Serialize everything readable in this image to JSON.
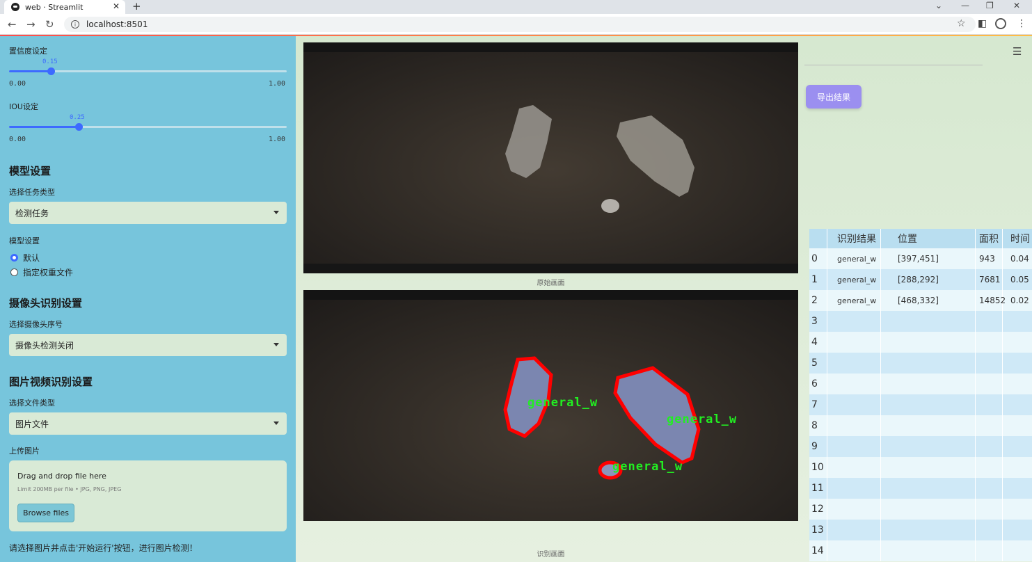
{
  "browser": {
    "tab_title": "web · Streamlit",
    "url": "localhost:8501"
  },
  "sidebar": {
    "confidence": {
      "label": "置信度设定",
      "value": "0.15",
      "min": "0.00",
      "max": "1.00",
      "fraction": 0.15
    },
    "iou": {
      "label": "IOU设定",
      "value": "0.25",
      "min": "0.00",
      "max": "1.00",
      "fraction": 0.25
    },
    "model_section": {
      "title": "模型设置",
      "task_label": "选择任务类型",
      "task_value": "检测任务",
      "model_label": "模型设置",
      "options": [
        "默认",
        "指定权重文件"
      ],
      "selected_index": 0
    },
    "camera_section": {
      "title": "摄像头识别设置",
      "camera_label": "选择摄像头序号",
      "camera_value": "摄像头检测关闭"
    },
    "media_section": {
      "title": "图片视频识别设置",
      "file_type_label": "选择文件类型",
      "file_type_value": "图片文件",
      "upload_label": "上传图片",
      "drag_text": "Drag and drop file here",
      "limit_text": "Limit 200MB per file • JPG, PNG, JPEG",
      "browse_label": "Browse files"
    },
    "hint": "请选择图片并点击'开始运行'按钮，进行图片检测！"
  },
  "main": {
    "original_caption": "原始画面",
    "result_caption": "识别画面",
    "export_label": "导出结果",
    "detections": [
      {
        "label": "general_w"
      },
      {
        "label": "general_w"
      },
      {
        "label": "general_w"
      }
    ]
  },
  "table": {
    "columns": [
      "",
      "识别结果",
      "位置",
      "面积",
      "时间"
    ],
    "rows": [
      [
        "0",
        "general_w",
        "[397,451]",
        "943",
        "0.04"
      ],
      [
        "1",
        "general_w",
        "[288,292]",
        "7681",
        "0.05"
      ],
      [
        "2",
        "general_w",
        "[468,332]",
        "14852",
        "0.02"
      ],
      [
        "3",
        "",
        "",
        "",
        ""
      ],
      [
        "4",
        "",
        "",
        "",
        ""
      ],
      [
        "5",
        "",
        "",
        "",
        ""
      ],
      [
        "6",
        "",
        "",
        "",
        ""
      ],
      [
        "7",
        "",
        "",
        "",
        ""
      ],
      [
        "8",
        "",
        "",
        "",
        ""
      ],
      [
        "9",
        "",
        "",
        "",
        ""
      ],
      [
        "10",
        "",
        "",
        "",
        ""
      ],
      [
        "11",
        "",
        "",
        "",
        ""
      ],
      [
        "12",
        "",
        "",
        "",
        ""
      ],
      [
        "13",
        "",
        "",
        "",
        ""
      ],
      [
        "14",
        "",
        "",
        "",
        ""
      ]
    ]
  },
  "colors": {
    "sidebar_bg": "#77c5dc",
    "accent": "#3d6aff",
    "export_button": "#9b8ff0",
    "detection_box": "#ff0000",
    "detection_text": "#22ee22"
  }
}
